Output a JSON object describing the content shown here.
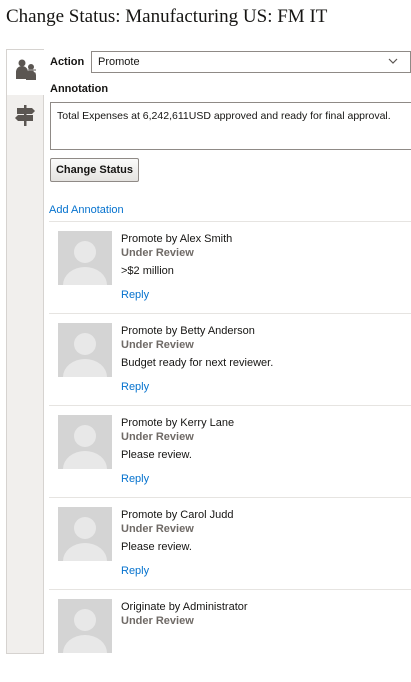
{
  "page": {
    "title": "Change Status: Manufacturing US: FM IT"
  },
  "tabs": [
    {
      "icon": "people-transfer-icon"
    },
    {
      "icon": "signpost-icon"
    }
  ],
  "form": {
    "action_label": "Action",
    "action_value": "Promote",
    "annotation_label": "Annotation",
    "annotation_value": "Total Expenses at 6,242,611USD approved and ready for final approval.",
    "submit_label": "Change Status"
  },
  "add_annotation_label": "Add Annotation",
  "annotations": [
    {
      "title": "Promote by Alex Smith",
      "status": "Under Review",
      "comment": ">$2 million",
      "reply": "Reply"
    },
    {
      "title": "Promote by Betty Anderson",
      "status": "Under Review",
      "comment": "Budget ready for next reviewer.",
      "reply": "Reply"
    },
    {
      "title": "Promote by Kerry Lane",
      "status": "Under Review",
      "comment": "Please review.",
      "reply": "Reply"
    },
    {
      "title": "Promote by Carol Judd",
      "status": "Under Review",
      "comment": "Please review.",
      "reply": "Reply"
    },
    {
      "title": "Originate by Administrator",
      "status": "Under Review",
      "comment": "",
      "reply": ""
    }
  ],
  "colors": {
    "link": "#0572ce",
    "status_text": "#6f6a66",
    "avatar": "#d4d4d4",
    "divider": "#e6e4e1"
  }
}
